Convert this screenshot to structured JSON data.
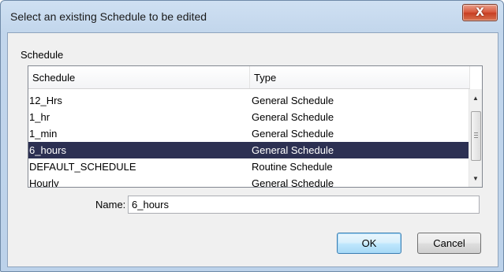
{
  "window": {
    "title": "Select an existing Schedule to be edited",
    "close_glyph": "X"
  },
  "group": {
    "label": "Schedule"
  },
  "list": {
    "columns": [
      "Schedule",
      "Type"
    ],
    "rows": [
      {
        "name": "12_Hrs",
        "type": "General Schedule"
      },
      {
        "name": "1_hr",
        "type": "General Schedule"
      },
      {
        "name": "1_min",
        "type": "General Schedule"
      },
      {
        "name": "6_hours",
        "type": "General Schedule",
        "selected": true
      },
      {
        "name": "DEFAULT_SCHEDULE",
        "type": "Routine Schedule"
      },
      {
        "name": "Hourly",
        "type": "General Schedule"
      }
    ]
  },
  "form": {
    "name_label": "Name:",
    "name_value": "6_hours"
  },
  "buttons": {
    "ok": "OK",
    "cancel": "Cancel"
  },
  "colors": {
    "selection_bg": "#2c3052",
    "selection_fg": "#ffffff",
    "close_button": "#c73e22"
  },
  "icons": {
    "scroll_up": "scroll-up-arrow-icon",
    "scroll_down": "scroll-down-arrow-icon",
    "close": "close-icon"
  }
}
